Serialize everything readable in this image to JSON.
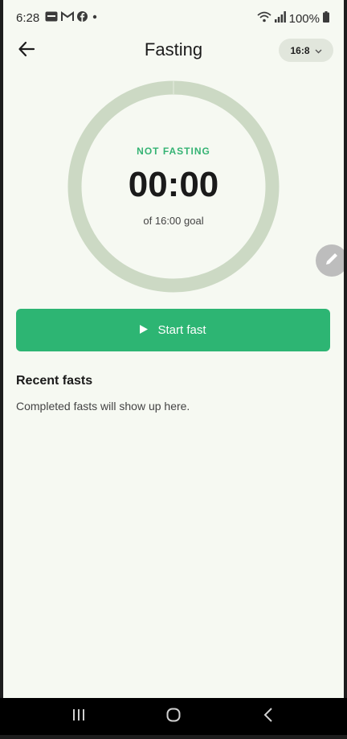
{
  "status_bar": {
    "time": "6:28",
    "battery": "100%",
    "icons": [
      "screen-icon",
      "gmail-icon",
      "facebook-icon",
      "dot-icon"
    ]
  },
  "app_bar": {
    "title": "Fasting",
    "plan": "16:8"
  },
  "timer": {
    "status": "NOT FASTING",
    "elapsed": "00:00",
    "goal": "of 16:00 goal",
    "progress": 0,
    "ring_color": "#ccd9c4"
  },
  "actions": {
    "start_label": "Start fast"
  },
  "recent": {
    "title": "Recent fasts",
    "empty": "Completed fasts will show up here."
  },
  "colors": {
    "accent": "#2db573",
    "background": "#f6f9f2"
  }
}
